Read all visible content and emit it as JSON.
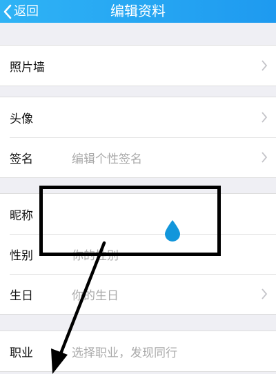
{
  "header": {
    "back_label": "返回",
    "title": "编辑资料"
  },
  "groups": [
    {
      "rows": [
        {
          "label": "照片墙",
          "value": "",
          "chevron": true
        }
      ]
    },
    {
      "rows": [
        {
          "label": "头像",
          "value": "",
          "chevron": true
        },
        {
          "label": "签名",
          "value": "编辑个性签名",
          "chevron": true
        }
      ]
    },
    {
      "rows": [
        {
          "label": "昵称",
          "value": "",
          "chevron": false
        },
        {
          "label": "性别",
          "value": "你的性别",
          "chevron": false
        },
        {
          "label": "生日",
          "value": "你的生日",
          "chevron": true
        }
      ]
    },
    {
      "rows": [
        {
          "label": "职业",
          "value": "选择职业，发现同行",
          "chevron": false
        }
      ]
    }
  ],
  "colors": {
    "nav_bar": "#1e9af0",
    "background": "#efeff4",
    "placeholder": "#a9a9a9",
    "drop_marker": "#1296db"
  },
  "icons": {
    "back": "chevron-left-icon",
    "row_arrow": "chevron-right-icon",
    "marker": "water-drop-icon"
  }
}
